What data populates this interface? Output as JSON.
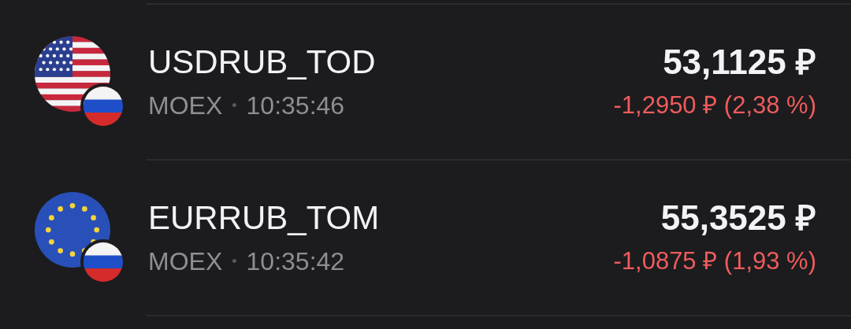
{
  "rows": [
    {
      "kind": "usd",
      "ticker": "USDRUB_TOD",
      "exchange": "MOEX",
      "separator": "•",
      "time": "10:35:46",
      "price": "53,1125 ₽",
      "change": "-1,2950 ₽ (2,38 %)"
    },
    {
      "kind": "eur",
      "ticker": "EURRUB_TOM",
      "exchange": "MOEX",
      "separator": "•",
      "time": "10:35:42",
      "price": "55,3525 ₽",
      "change": "-1,0875 ₽ (1,93 %)"
    }
  ]
}
